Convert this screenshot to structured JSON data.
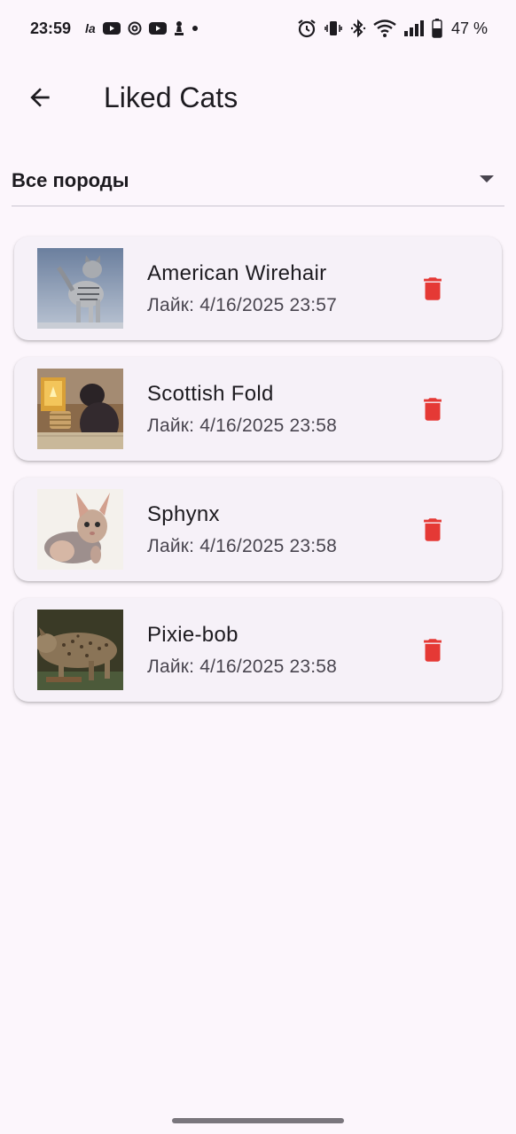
{
  "status_bar": {
    "time": "23:59",
    "battery_percent": "47 %",
    "notification_icons": [
      "la-icon",
      "youtube-icon",
      "threads-icon",
      "youtube-icon",
      "chess-pawn-icon",
      "dot-icon"
    ],
    "system_icons": [
      "alarm-icon",
      "vibrate-icon",
      "bluetooth-icon",
      "wifi-icon",
      "signal-icon",
      "battery-icon"
    ]
  },
  "app_bar": {
    "back_icon": "arrow-back-icon",
    "title": "Liked Cats"
  },
  "filter": {
    "selected": "Все породы",
    "icon": "dropdown-arrow-icon"
  },
  "cats": [
    {
      "name": "American Wirehair",
      "liked": "Лайк: 4/16/2025 23:57",
      "thumb": "american-wirehair-photo"
    },
    {
      "name": "Scottish Fold",
      "liked": "Лайк: 4/16/2025 23:58",
      "thumb": "scottish-fold-photo"
    },
    {
      "name": "Sphynx",
      "liked": "Лайк: 4/16/2025 23:58",
      "thumb": "sphynx-photo"
    },
    {
      "name": "Pixie-bob",
      "liked": "Лайк: 4/16/2025 23:58",
      "thumb": "pixie-bob-photo"
    }
  ],
  "colors": {
    "background": "#fcf6fc",
    "card": "#f6f1f8",
    "delete": "#e53935",
    "text_primary": "#1d1b20",
    "text_secondary": "#49454f"
  }
}
